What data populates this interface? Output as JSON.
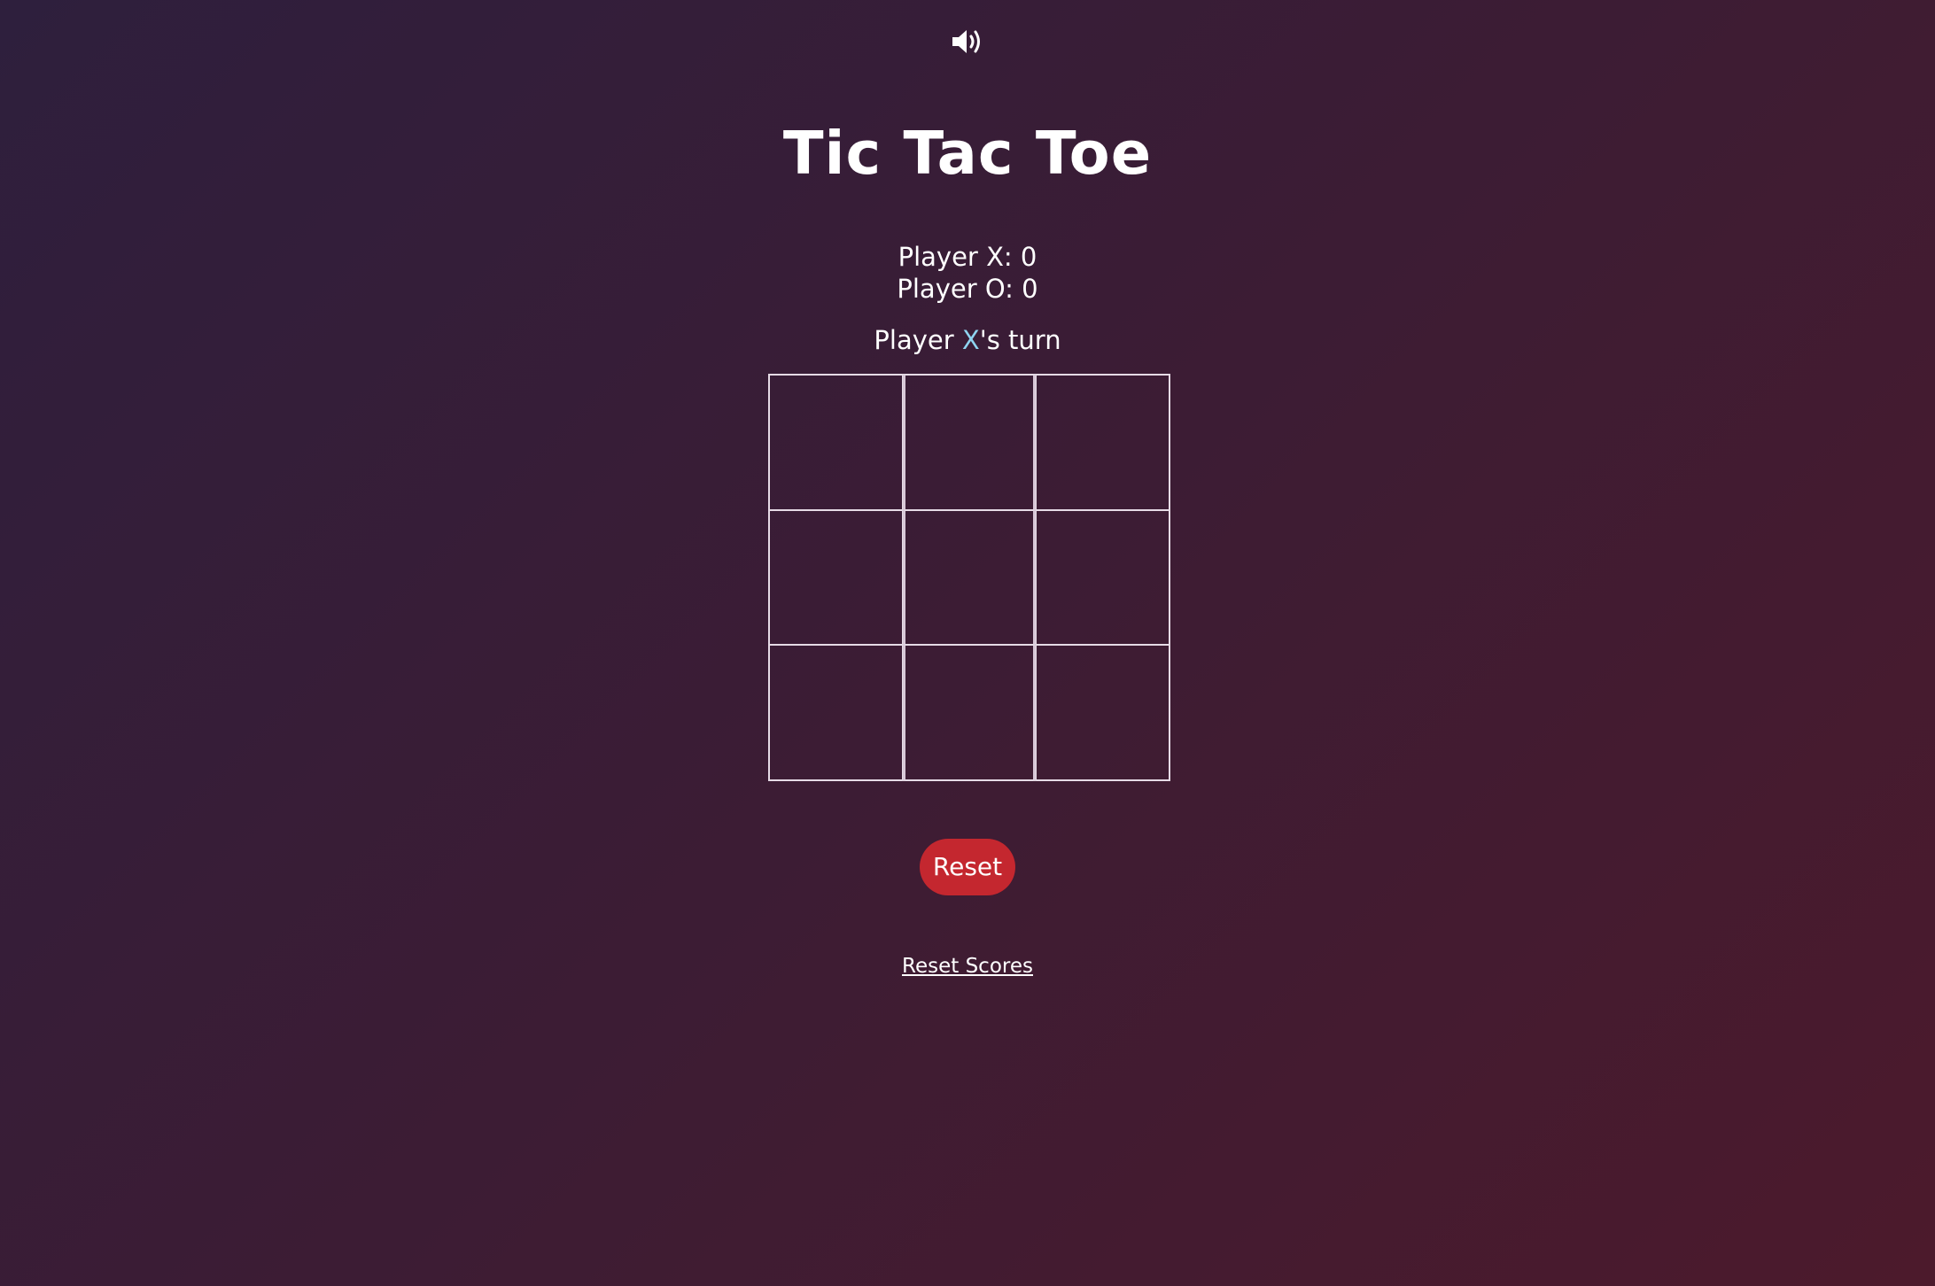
{
  "header": {
    "sound_icon": "speaker-volume-icon"
  },
  "title": "Tic Tac Toe",
  "scores": {
    "player_x_label": "Player X: 0",
    "player_o_label": "Player O: 0"
  },
  "turn": {
    "prefix": "Player ",
    "current_player": "X",
    "suffix": "'s turn"
  },
  "board": {
    "cells": [
      "",
      "",
      "",
      "",
      "",
      "",
      "",
      "",
      ""
    ]
  },
  "actions": {
    "reset_label": "Reset",
    "reset_scores_label": "Reset Scores"
  },
  "colors": {
    "background_start": "#2e1f3d",
    "background_end": "#4c1a2c",
    "accent_x": "#8fd3f0",
    "reset_button": "#c4272f",
    "grid_lines": "#e6dbe6"
  }
}
